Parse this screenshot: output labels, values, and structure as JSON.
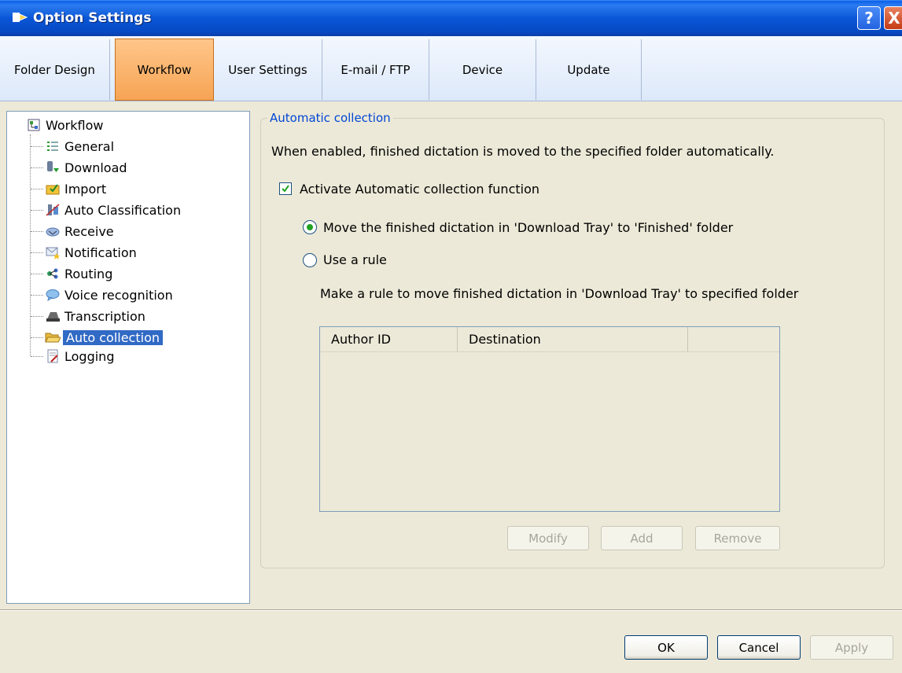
{
  "window": {
    "title": "Option Settings",
    "help_label": "?",
    "close_label": "X"
  },
  "tabs": [
    {
      "label": "Folder Design",
      "active": false
    },
    {
      "label": "Workflow",
      "active": true
    },
    {
      "label": "User Settings",
      "active": false
    },
    {
      "label": "E-mail / FTP",
      "active": false
    },
    {
      "label": "Device",
      "active": false
    },
    {
      "label": "Update",
      "active": false
    }
  ],
  "tree": {
    "root": "Workflow",
    "items": [
      {
        "label": "General",
        "icon": "list-icon"
      },
      {
        "label": "Download",
        "icon": "download-icon"
      },
      {
        "label": "Import",
        "icon": "import-icon"
      },
      {
        "label": "Auto Classification",
        "icon": "classification-icon"
      },
      {
        "label": "Receive",
        "icon": "receive-icon"
      },
      {
        "label": "Notification",
        "icon": "notification-icon"
      },
      {
        "label": "Routing",
        "icon": "routing-icon"
      },
      {
        "label": "Voice recognition",
        "icon": "speech-bubble-icon"
      },
      {
        "label": "Transcription",
        "icon": "transcription-icon"
      },
      {
        "label": "Auto collection",
        "icon": "folder-open-icon",
        "selected": true
      },
      {
        "label": "Logging",
        "icon": "log-icon"
      }
    ]
  },
  "panel": {
    "group_title": "Automatic collection",
    "description": "When enabled, finished dictation is moved to the specified folder automatically.",
    "activate_label": "Activate Automatic collection function",
    "activate_checked": true,
    "option_move_label": "Move the finished dictation in 'Download Tray' to 'Finished' folder",
    "option_move_selected": true,
    "option_rule_label": "Use a rule",
    "rule_hint": "Make a rule to move finished dictation in 'Download Tray' to specified folder",
    "columns": [
      "Author ID",
      "Destination"
    ],
    "modify_label": "Modify",
    "add_label": "Add",
    "remove_label": "Remove"
  },
  "footer": {
    "ok_label": "OK",
    "cancel_label": "Cancel",
    "apply_label": "Apply"
  }
}
